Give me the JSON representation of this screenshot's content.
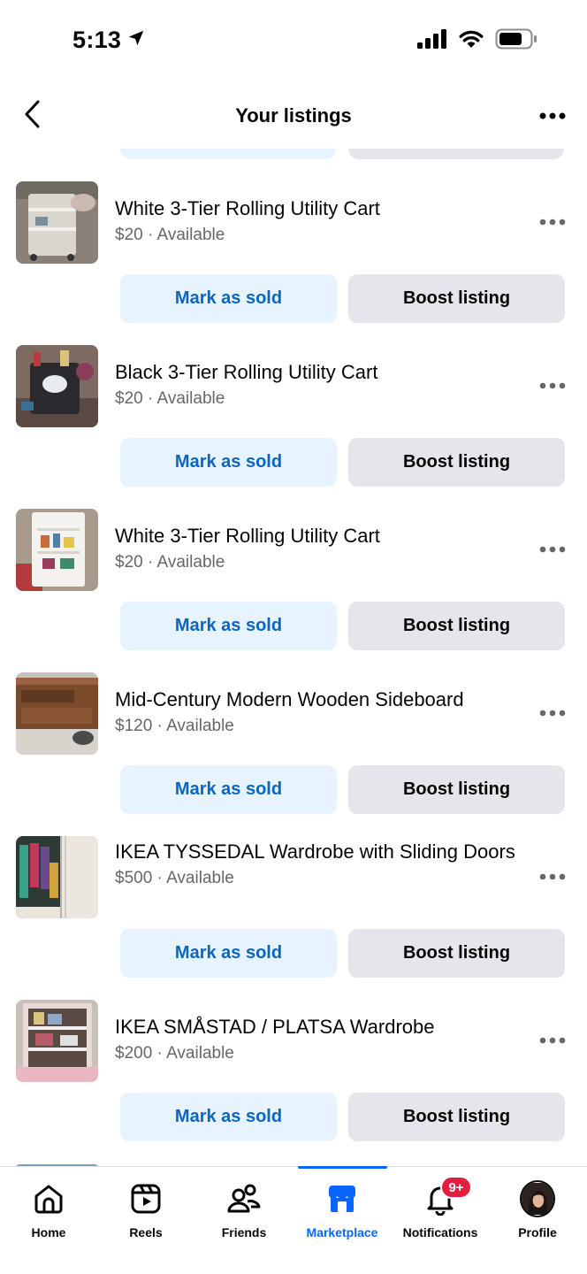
{
  "status_bar": {
    "time": "5:13",
    "icons": [
      "location-arrow-icon",
      "signal-icon",
      "wifi-icon",
      "battery-icon"
    ]
  },
  "header": {
    "title": "Your listings",
    "back_icon": "chevron-left-icon",
    "more_icon": "more-horizontal-icon"
  },
  "listings": [
    {
      "title": "White 3-Tier Rolling Utility Cart",
      "price": "$20",
      "status": "Available",
      "meta": "$20 · Available",
      "mark_sold_label": "Mark as sold",
      "boost_label": "Boost listing"
    },
    {
      "title": "Black 3-Tier Rolling Utility Cart",
      "price": "$20",
      "status": "Available",
      "meta": "$20 · Available",
      "mark_sold_label": "Mark as sold",
      "boost_label": "Boost listing"
    },
    {
      "title": "White 3-Tier Rolling Utility Cart",
      "price": "$20",
      "status": "Available",
      "meta": "$20 · Available",
      "mark_sold_label": "Mark as sold",
      "boost_label": "Boost listing"
    },
    {
      "title": "Mid-Century Modern Wooden Sideboard",
      "price": "$120",
      "status": "Available",
      "meta": "$120 · Available",
      "mark_sold_label": "Mark as sold",
      "boost_label": "Boost listing"
    },
    {
      "title": "IKEA TYSSEDAL Wardrobe with Sliding Doors",
      "price": "$500",
      "status": "Available",
      "meta": "$500 · Available",
      "mark_sold_label": "Mark as sold",
      "boost_label": "Boost listing"
    },
    {
      "title": "IKEA SMÅSTAD / PLATSA Wardrobe",
      "price": "$200",
      "status": "Available",
      "meta": "$200 · Available",
      "mark_sold_label": "Mark as sold",
      "boost_label": "Boost listing"
    }
  ],
  "tabbar": {
    "tabs": [
      {
        "label": "Home",
        "icon": "home-icon",
        "active": false
      },
      {
        "label": "Reels",
        "icon": "reels-icon",
        "active": false
      },
      {
        "label": "Friends",
        "icon": "friends-icon",
        "active": false
      },
      {
        "label": "Marketplace",
        "icon": "marketplace-icon",
        "active": true
      },
      {
        "label": "Notifications",
        "icon": "bell-icon",
        "active": false,
        "badge": "9+"
      },
      {
        "label": "Profile",
        "icon": "avatar",
        "active": false
      }
    ]
  },
  "colors": {
    "accent": "#0866ff",
    "mark_sold_bg": "#e7f3ff",
    "mark_sold_text": "#0a66c2",
    "boost_bg": "#e4e6eb",
    "secondary_text": "#65676b",
    "badge": "#e41e3f"
  }
}
